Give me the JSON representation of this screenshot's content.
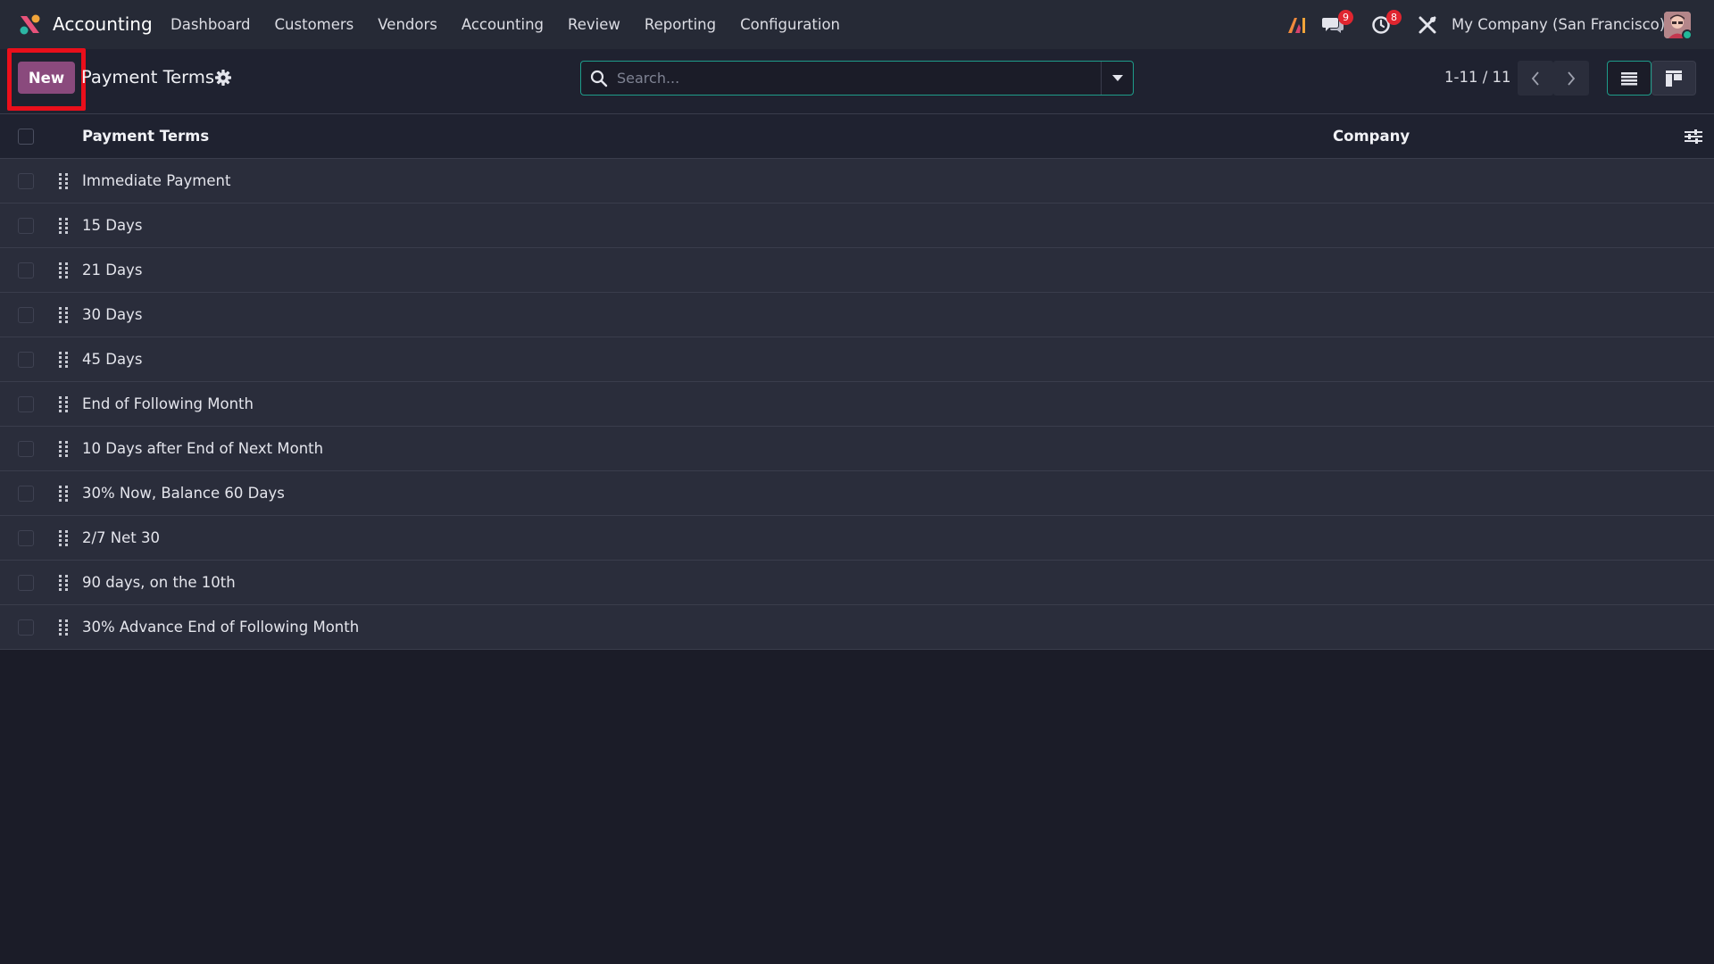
{
  "navbar": {
    "app_name": "Accounting",
    "menu": [
      "Dashboard",
      "Customers",
      "Vendors",
      "Accounting",
      "Review",
      "Reporting",
      "Configuration"
    ],
    "messages_count": "9",
    "activities_count": "8",
    "company": "My Company (San Francisco)",
    "icons": [
      "app-logo-icon",
      "ai-icon",
      "messages-icon",
      "activities-clock-icon",
      "debug-tools-icon",
      "avatar"
    ]
  },
  "control_panel": {
    "new_label": "New",
    "title": "Payment Terms",
    "search_placeholder": "Search...",
    "pager": "1-11 / 11"
  },
  "list": {
    "columns": [
      "Payment Terms",
      "Company"
    ],
    "rows": [
      "Immediate Payment",
      "15 Days",
      "21 Days",
      "30 Days",
      "45 Days",
      "End of Following Month",
      "10 Days after End of Next Month",
      "30% Now, Balance 60 Days",
      "2/7 Net 30",
      "90 days, on the 10th",
      "30% Advance End of Following Month"
    ]
  },
  "colors": {
    "primary": "#8a4a7d",
    "accent_teal": "#1e9c8a",
    "highlight_red": "#ea0f1b",
    "badge_red": "#e0252f",
    "navbar_bg": "#262a36",
    "page_bg": "#1b1c28"
  }
}
